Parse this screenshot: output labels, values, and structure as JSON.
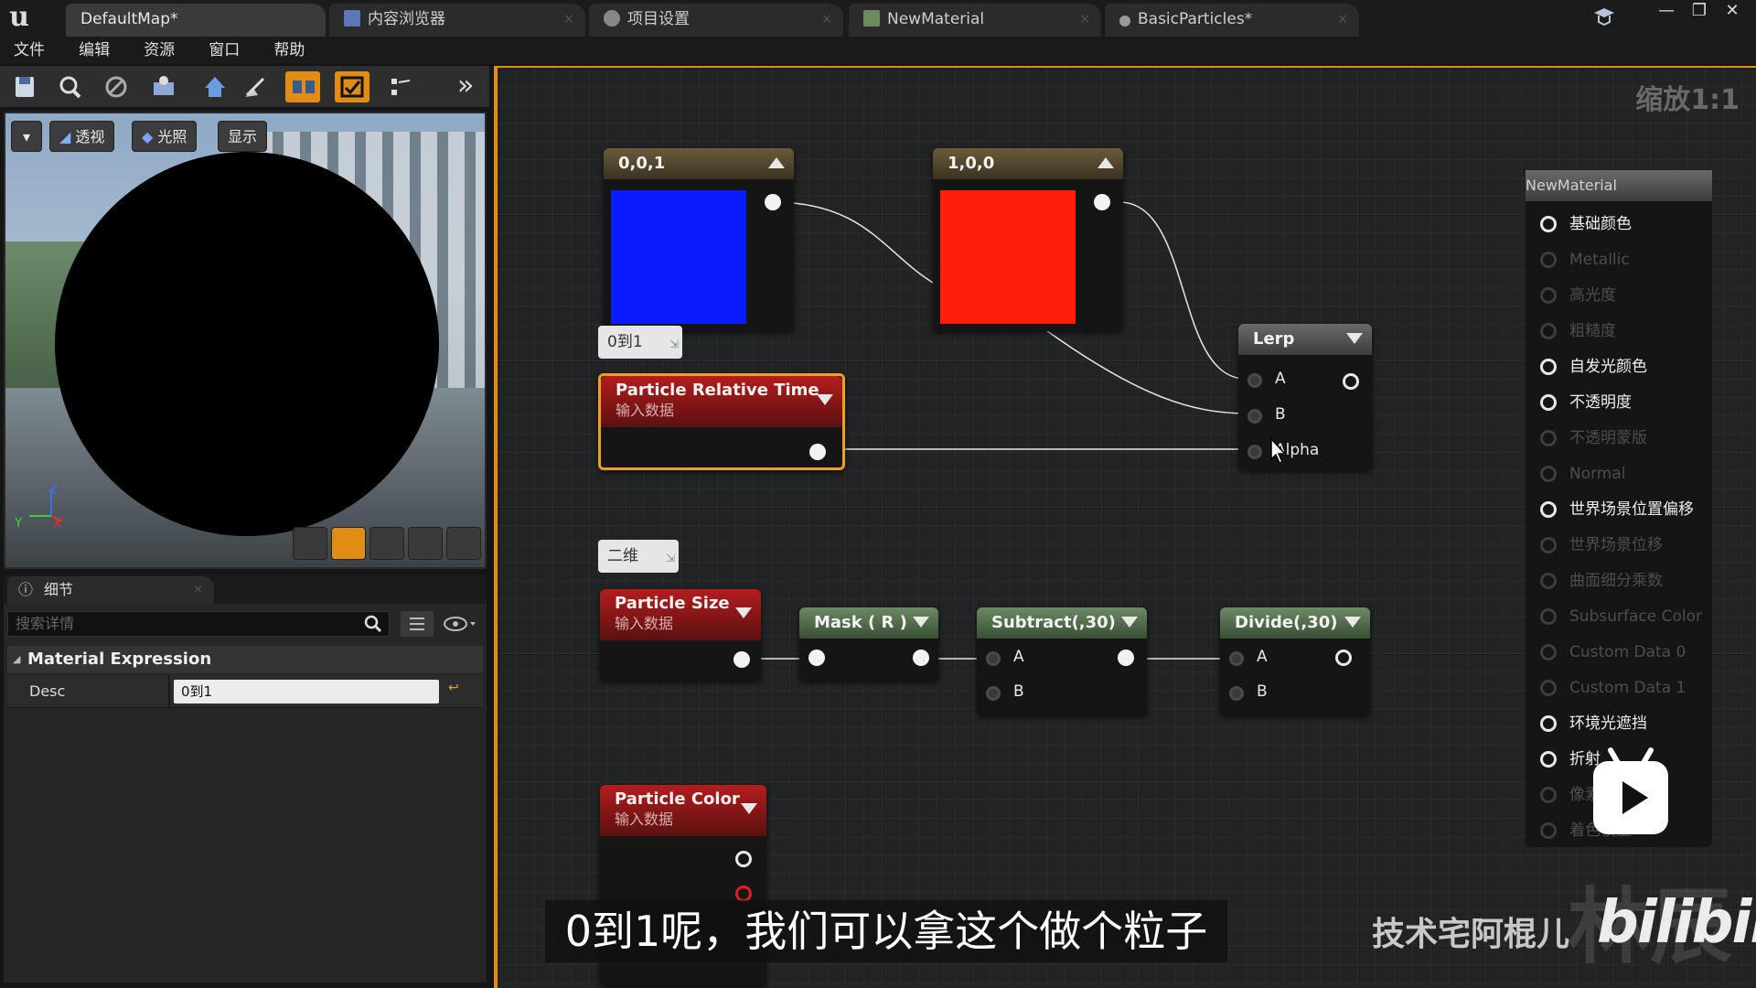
{
  "titlebar": {
    "tabs": [
      {
        "label": "DefaultMap*"
      },
      {
        "label": "内容浏览器"
      },
      {
        "label": "项目设置"
      },
      {
        "label": "NewMaterial"
      },
      {
        "label": "BasicParticles*"
      }
    ],
    "window_buttons": [
      "—",
      "❐",
      "✕"
    ]
  },
  "menu": [
    "文件",
    "编辑",
    "资源",
    "窗口",
    "帮助"
  ],
  "viewport": {
    "buttons": {
      "perspective": "透视",
      "lit": "光照",
      "show": "显示"
    },
    "axis": {
      "z": "Z",
      "y": "Y",
      "x": "X"
    }
  },
  "details": {
    "tab_label": "细节",
    "search_placeholder": "搜索详情",
    "section": "Material Expression",
    "props": [
      {
        "name": "Desc",
        "value": "0到1"
      }
    ]
  },
  "graph": {
    "zoom_label": "缩放1:1",
    "nodes": {
      "const_blue": {
        "title": "0,0,1",
        "color": "#0a1cff"
      },
      "const_red": {
        "title": "1,0,0",
        "color": "#ff1e0a"
      },
      "relative_time": {
        "title": "Particle Relative Time",
        "subtitle": "输入数据",
        "comment": "0到1"
      },
      "lerp": {
        "title": "Lerp",
        "pins": [
          "A",
          "B",
          "Alpha"
        ]
      },
      "particle_size": {
        "title": "Particle Size",
        "subtitle": "输入数据",
        "comment": "二维"
      },
      "mask": {
        "title": "Mask ( R )"
      },
      "subtract": {
        "title": "Subtract(,30)",
        "pins": [
          "A",
          "B"
        ]
      },
      "divide": {
        "title": "Divide(,30)",
        "pins": [
          "A",
          "B"
        ]
      },
      "particle_color": {
        "title": "Particle Color",
        "subtitle": "输入数据"
      }
    },
    "output": {
      "title": "NewMaterial",
      "rows": [
        {
          "label": "基础颜色",
          "active": true
        },
        {
          "label": "Metallic",
          "active": false
        },
        {
          "label": "高光度",
          "active": false
        },
        {
          "label": "粗糙度",
          "active": false
        },
        {
          "label": "自发光颜色",
          "active": true
        },
        {
          "label": "不透明度",
          "active": true
        },
        {
          "label": "不透明蒙版",
          "active": false
        },
        {
          "label": "Normal",
          "active": false
        },
        {
          "label": "世界场景位置偏移",
          "active": true
        },
        {
          "label": "世界场景位移",
          "active": false
        },
        {
          "label": "曲面细分乘数",
          "active": false
        },
        {
          "label": "Subsurface Color",
          "active": false
        },
        {
          "label": "Custom Data 0",
          "active": false
        },
        {
          "label": "Custom Data 1",
          "active": false
        },
        {
          "label": "环境光遮挡",
          "active": true
        },
        {
          "label": "折射",
          "active": true
        },
        {
          "label": "像素深度",
          "active": false
        },
        {
          "label": "着色模型",
          "active": false
        }
      ]
    }
  },
  "overlay": {
    "subtitle": "0到1呢，我们可以拿这个做个粒子",
    "watermark": "技术宅阿棍儿",
    "brand": "bilibili"
  }
}
